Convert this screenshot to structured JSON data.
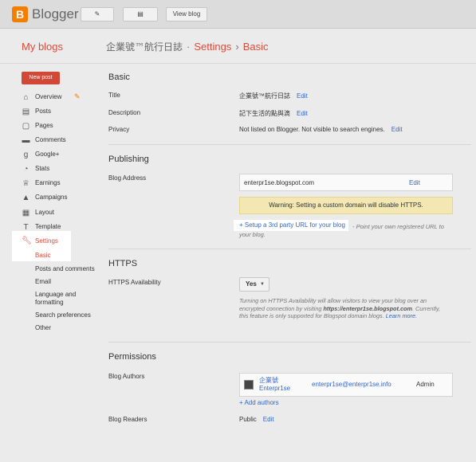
{
  "topbar": {
    "logo_letter": "B",
    "app_name": "Blogger",
    "pencil_icon": "✎",
    "posts_icon": "▤",
    "view_blog_label": "View blog"
  },
  "header": {
    "my_blogs": "My blogs",
    "blog_name": "企業號™航行日誌",
    "sep1": "·",
    "settings": "Settings",
    "sep2": "›",
    "page": "Basic"
  },
  "sidebar": {
    "new_post": "New post",
    "items": [
      {
        "label": "Overview",
        "icon": "⌂"
      },
      {
        "label": "Posts",
        "icon": "▤"
      },
      {
        "label": "Pages",
        "icon": "▢"
      },
      {
        "label": "Comments",
        "icon": "▬"
      },
      {
        "label": "Google+",
        "icon": "g"
      },
      {
        "label": "Stats",
        "icon": "◔"
      },
      {
        "label": "Earnings",
        "icon": "♕"
      },
      {
        "label": "Campaigns",
        "icon": "▲"
      },
      {
        "label": "Layout",
        "icon": "▦"
      },
      {
        "label": "Template",
        "icon": "T"
      },
      {
        "label": "Settings",
        "icon": "✗"
      }
    ],
    "settings_sub": [
      "Basic",
      "Posts and comments",
      "Email",
      "Language and formatting",
      "Search preferences",
      "Other"
    ]
  },
  "basic": {
    "title": "Basic",
    "title_label": "Title",
    "title_value": "企業號™航行日誌",
    "description_label": "Description",
    "description_value": "記下生活的點與滴",
    "privacy_label": "Privacy",
    "privacy_value": "Not listed on Blogger. Not visible to search engines.",
    "edit": "Edit"
  },
  "publishing": {
    "title": "Publishing",
    "blog_address_label": "Blog Address",
    "blog_address": "enterpr1se.blogspot.com",
    "edit": "Edit",
    "warning": "Warning: Setting a custom domain will disable HTTPS.",
    "third_party_link": "+ Setup a 3rd party URL for your blog",
    "third_party_hint": "- Point your own registered URL to your blog."
  },
  "https": {
    "title": "HTTPS",
    "availability_label": "HTTPS Availability",
    "select_value": "Yes",
    "note_before": "Turning on HTTPS Availability will allow visitors to view your blog over an encrypted connection by visiting ",
    "note_url": "https://enterpr1se.blogspot.com",
    "note_after": ". Currently, this feature is only supported for Blogspot domain blogs. ",
    "learn_more": "Learn more."
  },
  "permissions": {
    "title": "Permissions",
    "authors_label": "Blog Authors",
    "author_name_line1": "企業號",
    "author_name_line2": "Enterpr1se",
    "author_email": "enterpr1se@enterpr1se.info",
    "author_role": "Admin",
    "add_authors": "+ Add authors",
    "readers_label": "Blog Readers",
    "readers_value": "Public",
    "edit": "Edit"
  },
  "colors": {
    "accent": "#dd4b39",
    "link": "#3366cc",
    "logo": "#f57d00",
    "warning_bg": "#f3e8b4"
  }
}
